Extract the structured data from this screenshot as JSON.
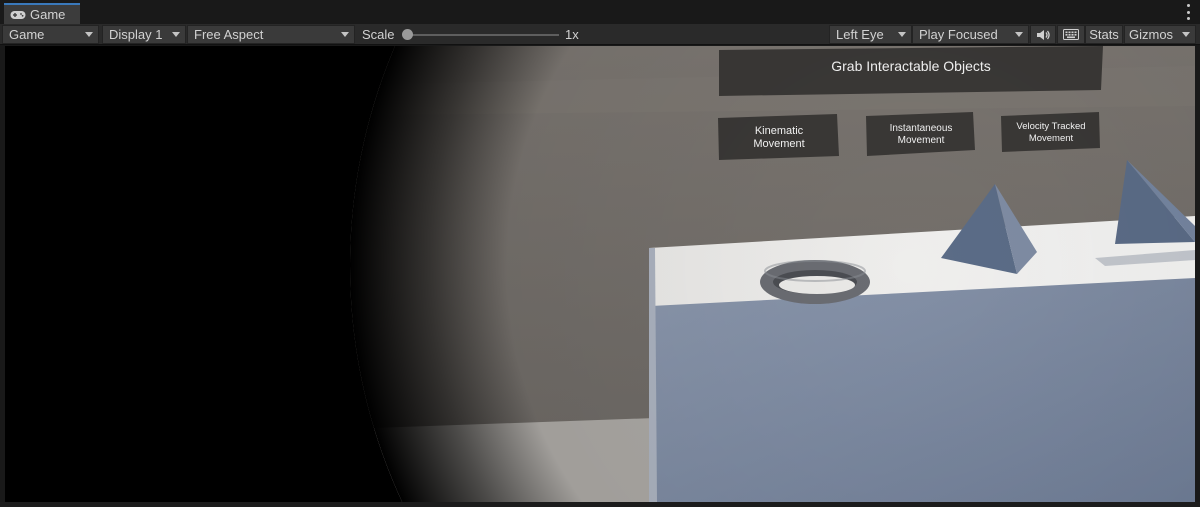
{
  "tab": {
    "label": "Game",
    "icon": "gamepad-icon"
  },
  "toolbar": {
    "view_mode": "Game",
    "display": "Display 1",
    "aspect": "Free Aspect",
    "scale_label": "Scale",
    "scale_value": "1x",
    "eye": "Left Eye",
    "play_mode": "Play Focused",
    "stats_label": "Stats",
    "gizmos_label": "Gizmos"
  },
  "scene": {
    "title_sign": "Grab Interactable Objects",
    "signs": [
      {
        "line1": "Kinematic",
        "line2": "Movement"
      },
      {
        "line1": "Instantaneous",
        "line2": "Movement"
      },
      {
        "line1": "Velocity Tracked",
        "line2": "Movement"
      }
    ]
  },
  "colors": {
    "tab_accent": "#3a79bb",
    "panel_bg": "#191919",
    "toolbar_bg": "#2a2a2a",
    "sign_bg": "#3a3836",
    "table_front": "#7c8aa2"
  }
}
